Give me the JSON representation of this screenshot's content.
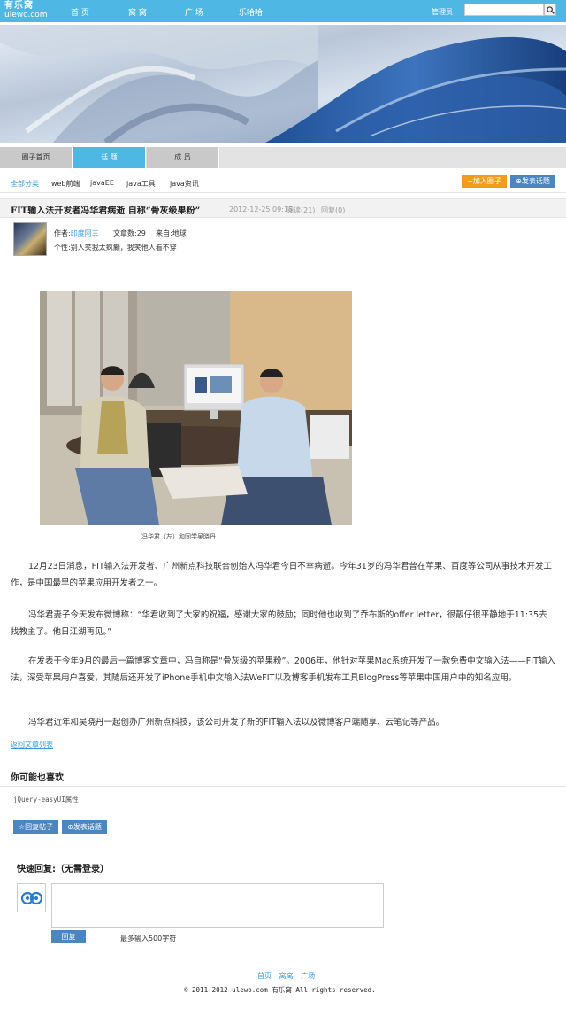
{
  "brand": {
    "logo_cn": "有乐窝",
    "logo_domain": "ulewo.com"
  },
  "nav": {
    "home": "首 页",
    "nest": "窝 窝",
    "plaza": "广 场",
    "fun": "乐哈哈",
    "admin": "管理员"
  },
  "search": {
    "placeholder": ""
  },
  "tabs": {
    "home": "圈子首页",
    "topic": "话  题",
    "members": "成  员"
  },
  "subnav": {
    "all": "全部分类",
    "web": "web前端",
    "javaee": "javaEE",
    "javatools": "java工具",
    "javanews": "java资讯"
  },
  "actions": {
    "join": "+加入圈子",
    "post": "⊕发表话题"
  },
  "post": {
    "title": "FIT输入法开发者冯华君病逝 自称“骨灰级果粉”",
    "datetime": "2012-12-25 09:15",
    "views": "阅读(21)",
    "replies": "回复(0)"
  },
  "author": {
    "label": "作者:",
    "name": "印度阿三",
    "articles": "文章数:29",
    "from": "来自:地球",
    "signature": "个性:别人笑我太疯癫，我笑他人看不穿"
  },
  "photo_caption": "冯华君（左）和同学吴晓丹",
  "paragraphs": {
    "p1": "12月23日消息，FIT输入法开发者、广州新点科技联合创始人冯华君今日不幸病逝。今年31岁的冯华君曾在苹果、百度等公司从事技术开发工作，是中国最早的苹果应用开发者之一。",
    "p2": "冯华君妻子今天发布微博称：“华君收到了大家的祝福，感谢大家的鼓励；同时他也收到了乔布斯的offer letter，很靓仔很平静地于11:35去找教主了。他日江湖再见。”",
    "p3": "在发表于今年9月的最后一篇博客文章中，冯自称是“骨灰级的苹果粉”。2006年，他针对苹果Mac系统开发了一款免费中文输入法——FIT输入法，深受苹果用户喜爱，其随后还开发了iPhone手机中文输入法WeFIT以及博客手机发布工具BlogPress等苹果中国用户中的知名应用。",
    "p4": "冯华君近年和吴晓丹一起创办广州新点科技，该公司开发了新的FIT输入法以及微博客户端随享、云笔记等产品。"
  },
  "back_link": "返回文章列表",
  "maylike": {
    "title": "你可能也喜欢",
    "item": "jQuery-easyUI属性"
  },
  "bottom_actions": {
    "reply": "☆回复帖子",
    "post": "⊕发表话题"
  },
  "quick_reply": {
    "title": "快速回复:（无需登录）",
    "button": "回复",
    "hint": "最多输入500字符"
  },
  "footer": {
    "links": {
      "home": "首页",
      "nest": "窝窝",
      "plaza": "广场"
    },
    "copyright": "© 2011-2012  ulewo.com 有乐窝 All rights reserved."
  },
  "colors": {
    "nav_bg": "#4fb7e4",
    "orange": "#f29b1d",
    "blue_btn": "#4c86c0",
    "link": "#3a9ad9"
  }
}
